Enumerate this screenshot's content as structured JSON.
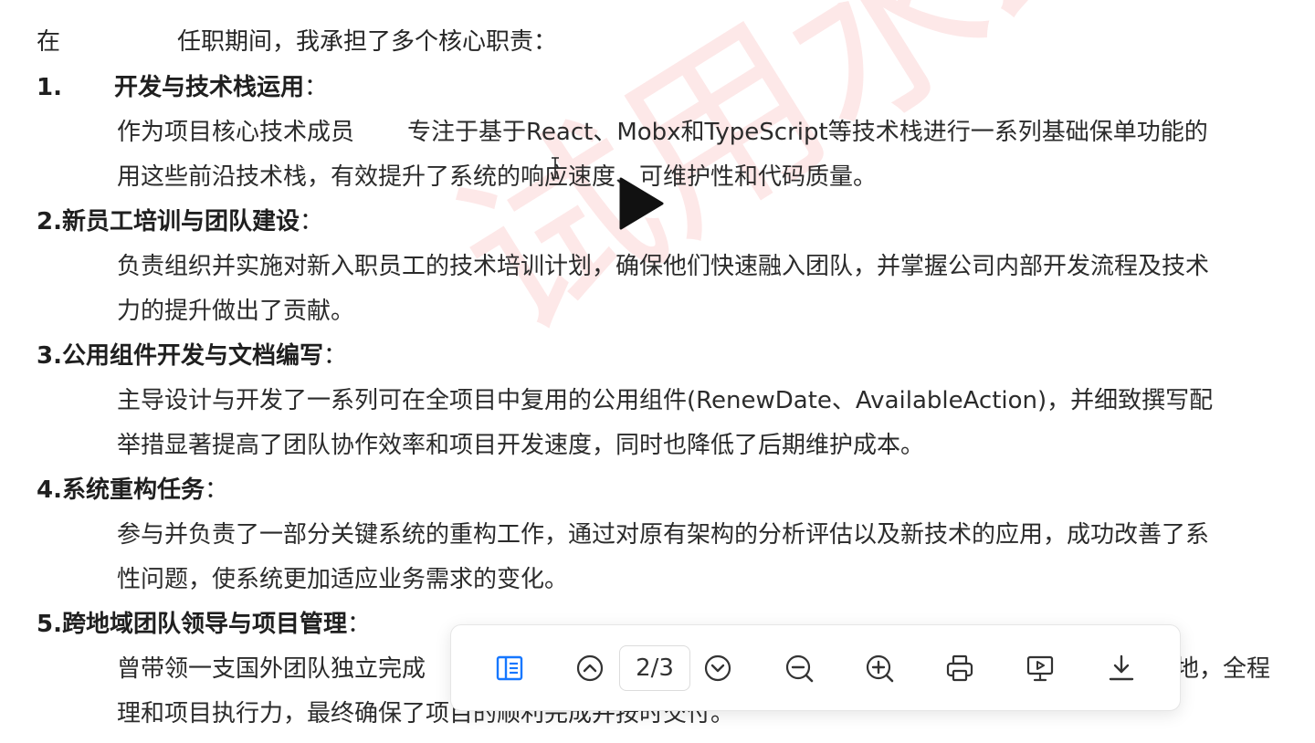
{
  "document": {
    "intro": {
      "start": "在",
      "rest": "任职期间，我承担了多个核心职责："
    },
    "sections": [
      {
        "heading": "1.",
        "heading_title": "开发与技术栈运用",
        "lines": [
          {
            "a": "作为项目核心技术成员",
            "b": "专注于基于React、Mobx和TypeScript等技术栈进行一系列基础保单功能的"
          },
          {
            "a": "用这些前沿技术栈，有效提升了系统的响应速度、可维护性和代码质量。"
          }
        ]
      },
      {
        "heading": "2.新员工培训与团队建设",
        "lines": [
          {
            "a": "负责组织并实施对新入职员工的技术培训计划，确保他们快速融入团队，并掌握公司内部开发流程及技术"
          },
          {
            "a": "力的提升做出了贡献。"
          }
        ]
      },
      {
        "heading": "3.公用组件开发与文档编写",
        "lines": [
          {
            "a": "主导设计与开发了一系列可在全项目中复用的公用组件(RenewDate、AvailableAction)，并细致撰写配"
          },
          {
            "a": "举措显著提高了团队协作效率和项目开发速度，同时也降低了后期维护成本。"
          }
        ]
      },
      {
        "heading": "4.系统重构任务",
        "lines": [
          {
            "a": "参与并负责了一部分关键系统的重构工作，通过对原有架构的分析评估以及新技术的应用，成功改善了系"
          },
          {
            "a": "性问题，使系统更加适应业务需求的变化。"
          }
        ]
      },
      {
        "heading": "5.跨地域团队领导与项目管理",
        "lines": [
          {
            "a": "曾带领一支国外团队独立完成",
            "b": "落地，全程"
          },
          {
            "a": "理和项目执行力，最终确保了项目的顺利完成并按时交付。"
          }
        ]
      }
    ],
    "colon": "："
  },
  "watermark": {
    "text": "试用水印",
    "color": "#f05a5a"
  },
  "toolbar": {
    "page_indicator": "2/3",
    "icons": [
      "sidebar-toggle-icon",
      "page-up-icon",
      "page-down-icon",
      "zoom-out-icon",
      "zoom-in-icon",
      "print-icon",
      "presentation-icon",
      "download-icon"
    ],
    "accent_color": "#1677ff"
  }
}
